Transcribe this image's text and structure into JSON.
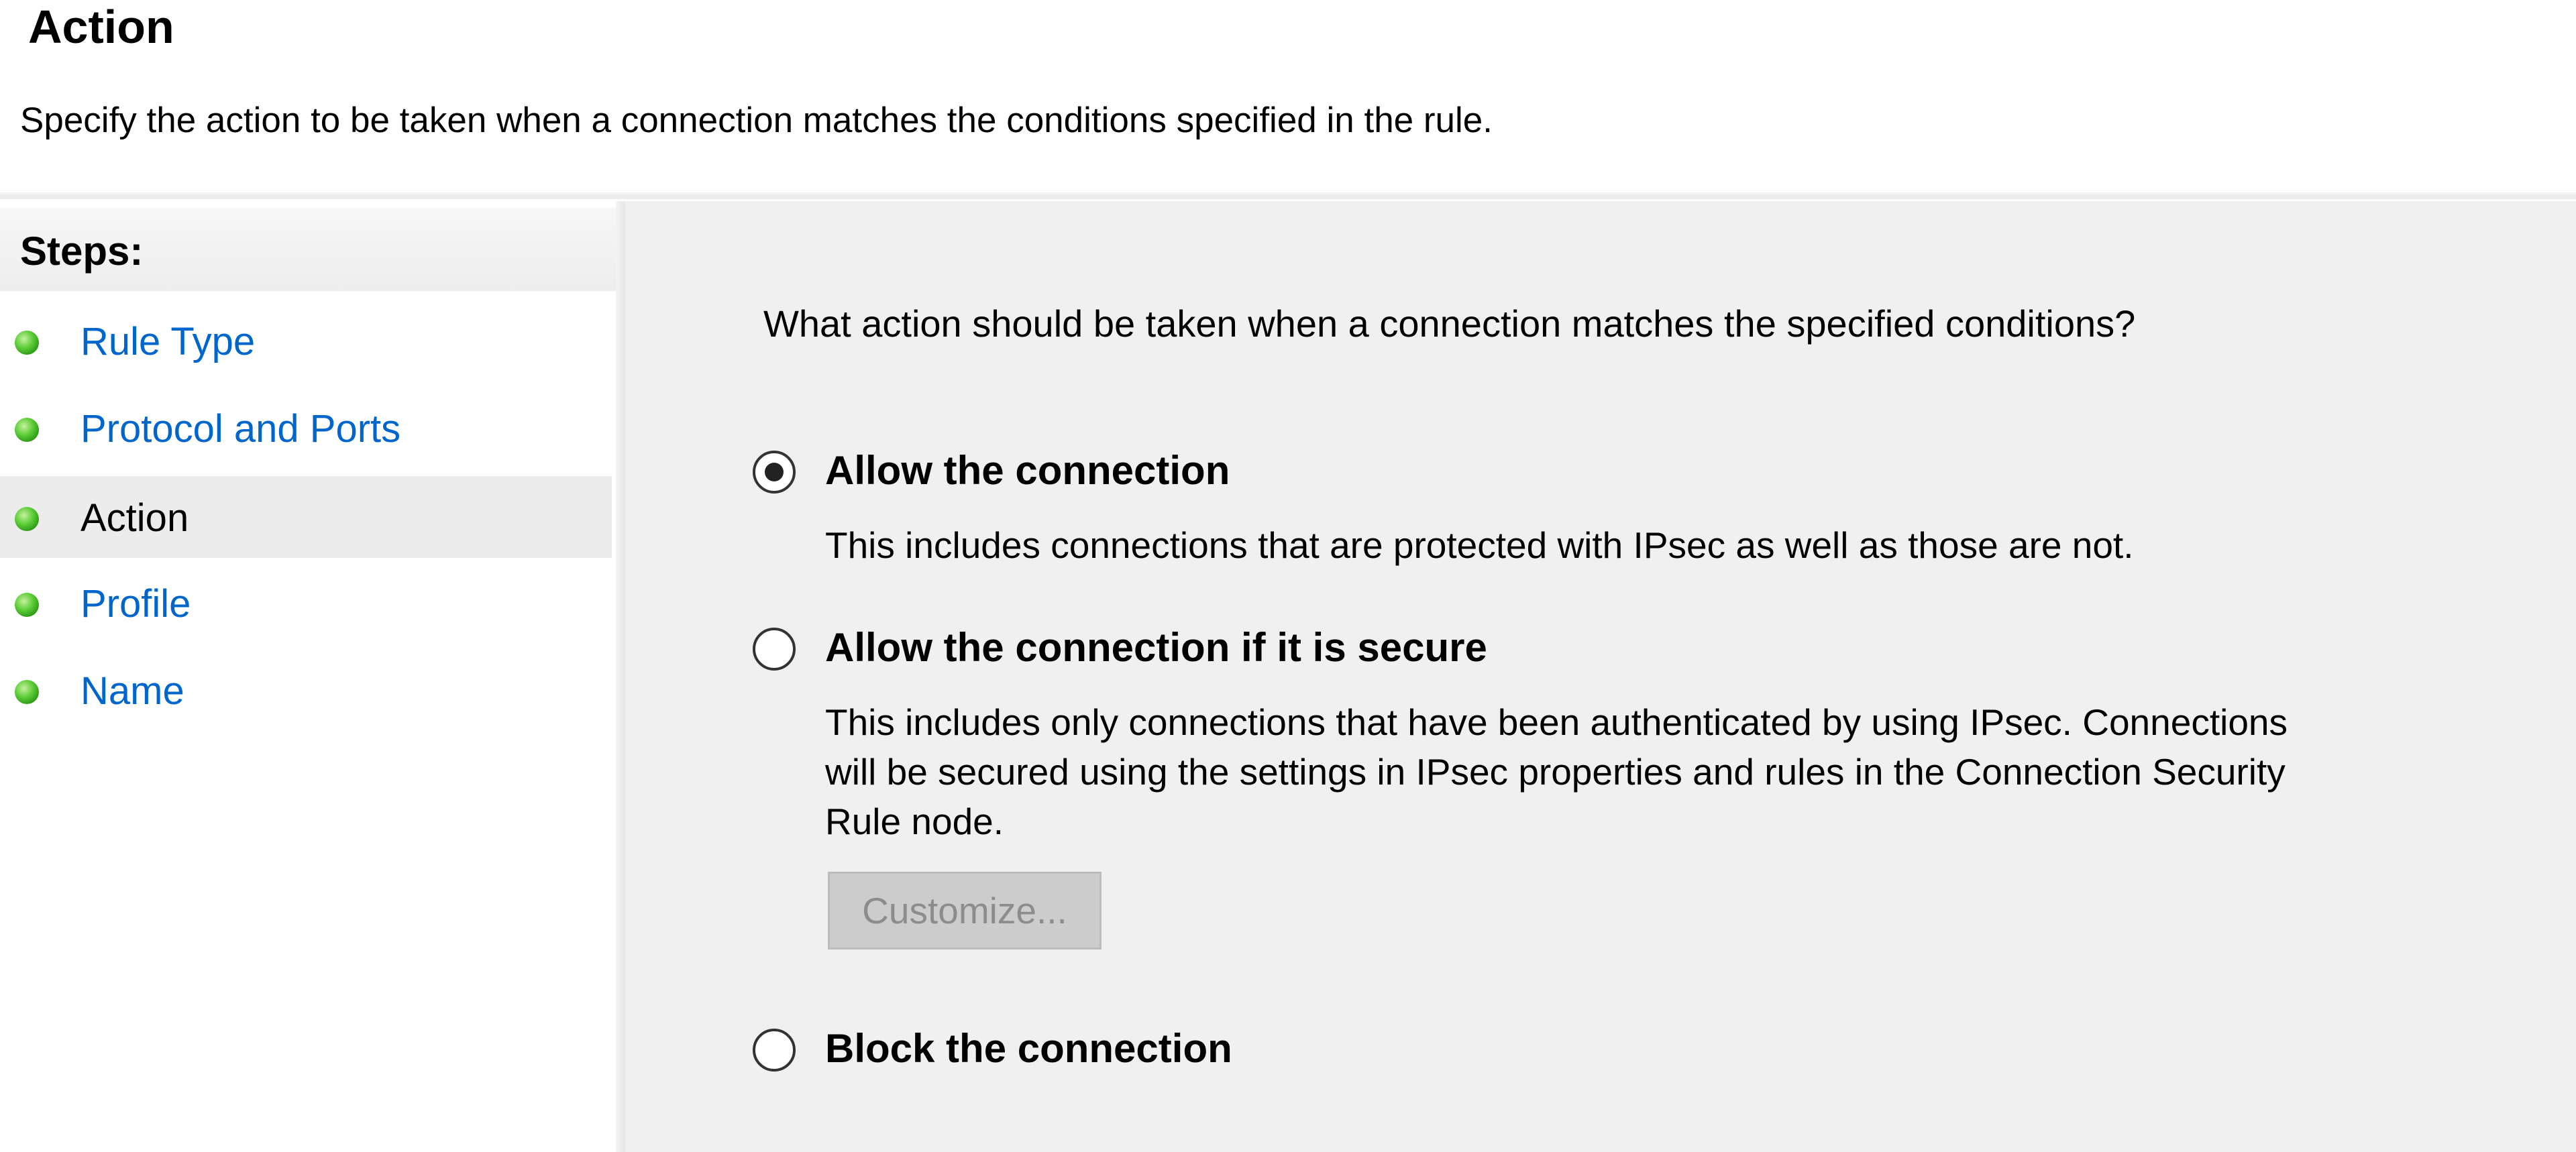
{
  "header": {
    "title": "Action",
    "description": "Specify the action to be taken when a connection matches the conditions specified in the rule."
  },
  "sidebar": {
    "header": "Steps:",
    "items": [
      {
        "label": "Rule Type",
        "status": "complete"
      },
      {
        "label": "Protocol and Ports",
        "status": "complete"
      },
      {
        "label": "Action",
        "status": "current"
      },
      {
        "label": "Profile",
        "status": "complete"
      },
      {
        "label": "Name",
        "status": "complete"
      }
    ]
  },
  "main": {
    "question": "What action should be taken when a connection matches the specified conditions?",
    "options": [
      {
        "label": "Allow the connection",
        "checked": true,
        "description": "This includes connections that are protected with IPsec as well as those are not."
      },
      {
        "label": "Allow the connection if it is secure",
        "checked": false,
        "description_lines": [
          "This includes only connections that have been authenticated by using IPsec.  Connections",
          "will be secured using the settings in IPsec properties and rules in the Connection Security",
          "Rule node."
        ]
      },
      {
        "label": "Block the connection",
        "checked": false
      }
    ],
    "customize_label": "Customize..."
  },
  "colors": {
    "link": "#0066cc",
    "panel_bg": "#f0f0f0",
    "active_step_bg": "#ececec",
    "step_dot": "#3aa81f"
  },
  "icons": {
    "step_status": "green-dot-icon",
    "radio": "radio-button-icon"
  }
}
